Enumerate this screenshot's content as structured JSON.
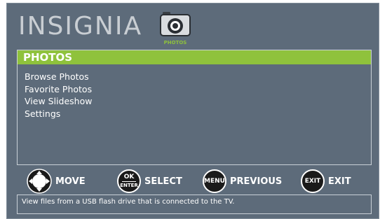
{
  "brand": {
    "name": "INSIGNIA"
  },
  "header": {
    "icon": "camera-icon",
    "caption": "PHOTOS"
  },
  "colors": {
    "accent": "#8fc23c",
    "background": "#5d6b7a",
    "border": "#c9d0d7"
  },
  "panel": {
    "title": "PHOTOS",
    "items": [
      {
        "label": "Browse Photos"
      },
      {
        "label": "Favorite Photos"
      },
      {
        "label": "View Slideshow"
      },
      {
        "label": "Settings"
      }
    ]
  },
  "controls": [
    {
      "icon": "dpad-icon",
      "label": "MOVE"
    },
    {
      "icon": "ok-enter-icon",
      "icon_text_top": "OK",
      "icon_text_bottom": "ENTER",
      "label": "SELECT"
    },
    {
      "icon": "menu-icon",
      "icon_text": "MENU",
      "label": "PREVIOUS"
    },
    {
      "icon": "exit-icon",
      "icon_text": "EXIT",
      "label": "EXIT"
    }
  ],
  "status": {
    "text": "View files from a USB flash drive that is connected to the TV."
  }
}
